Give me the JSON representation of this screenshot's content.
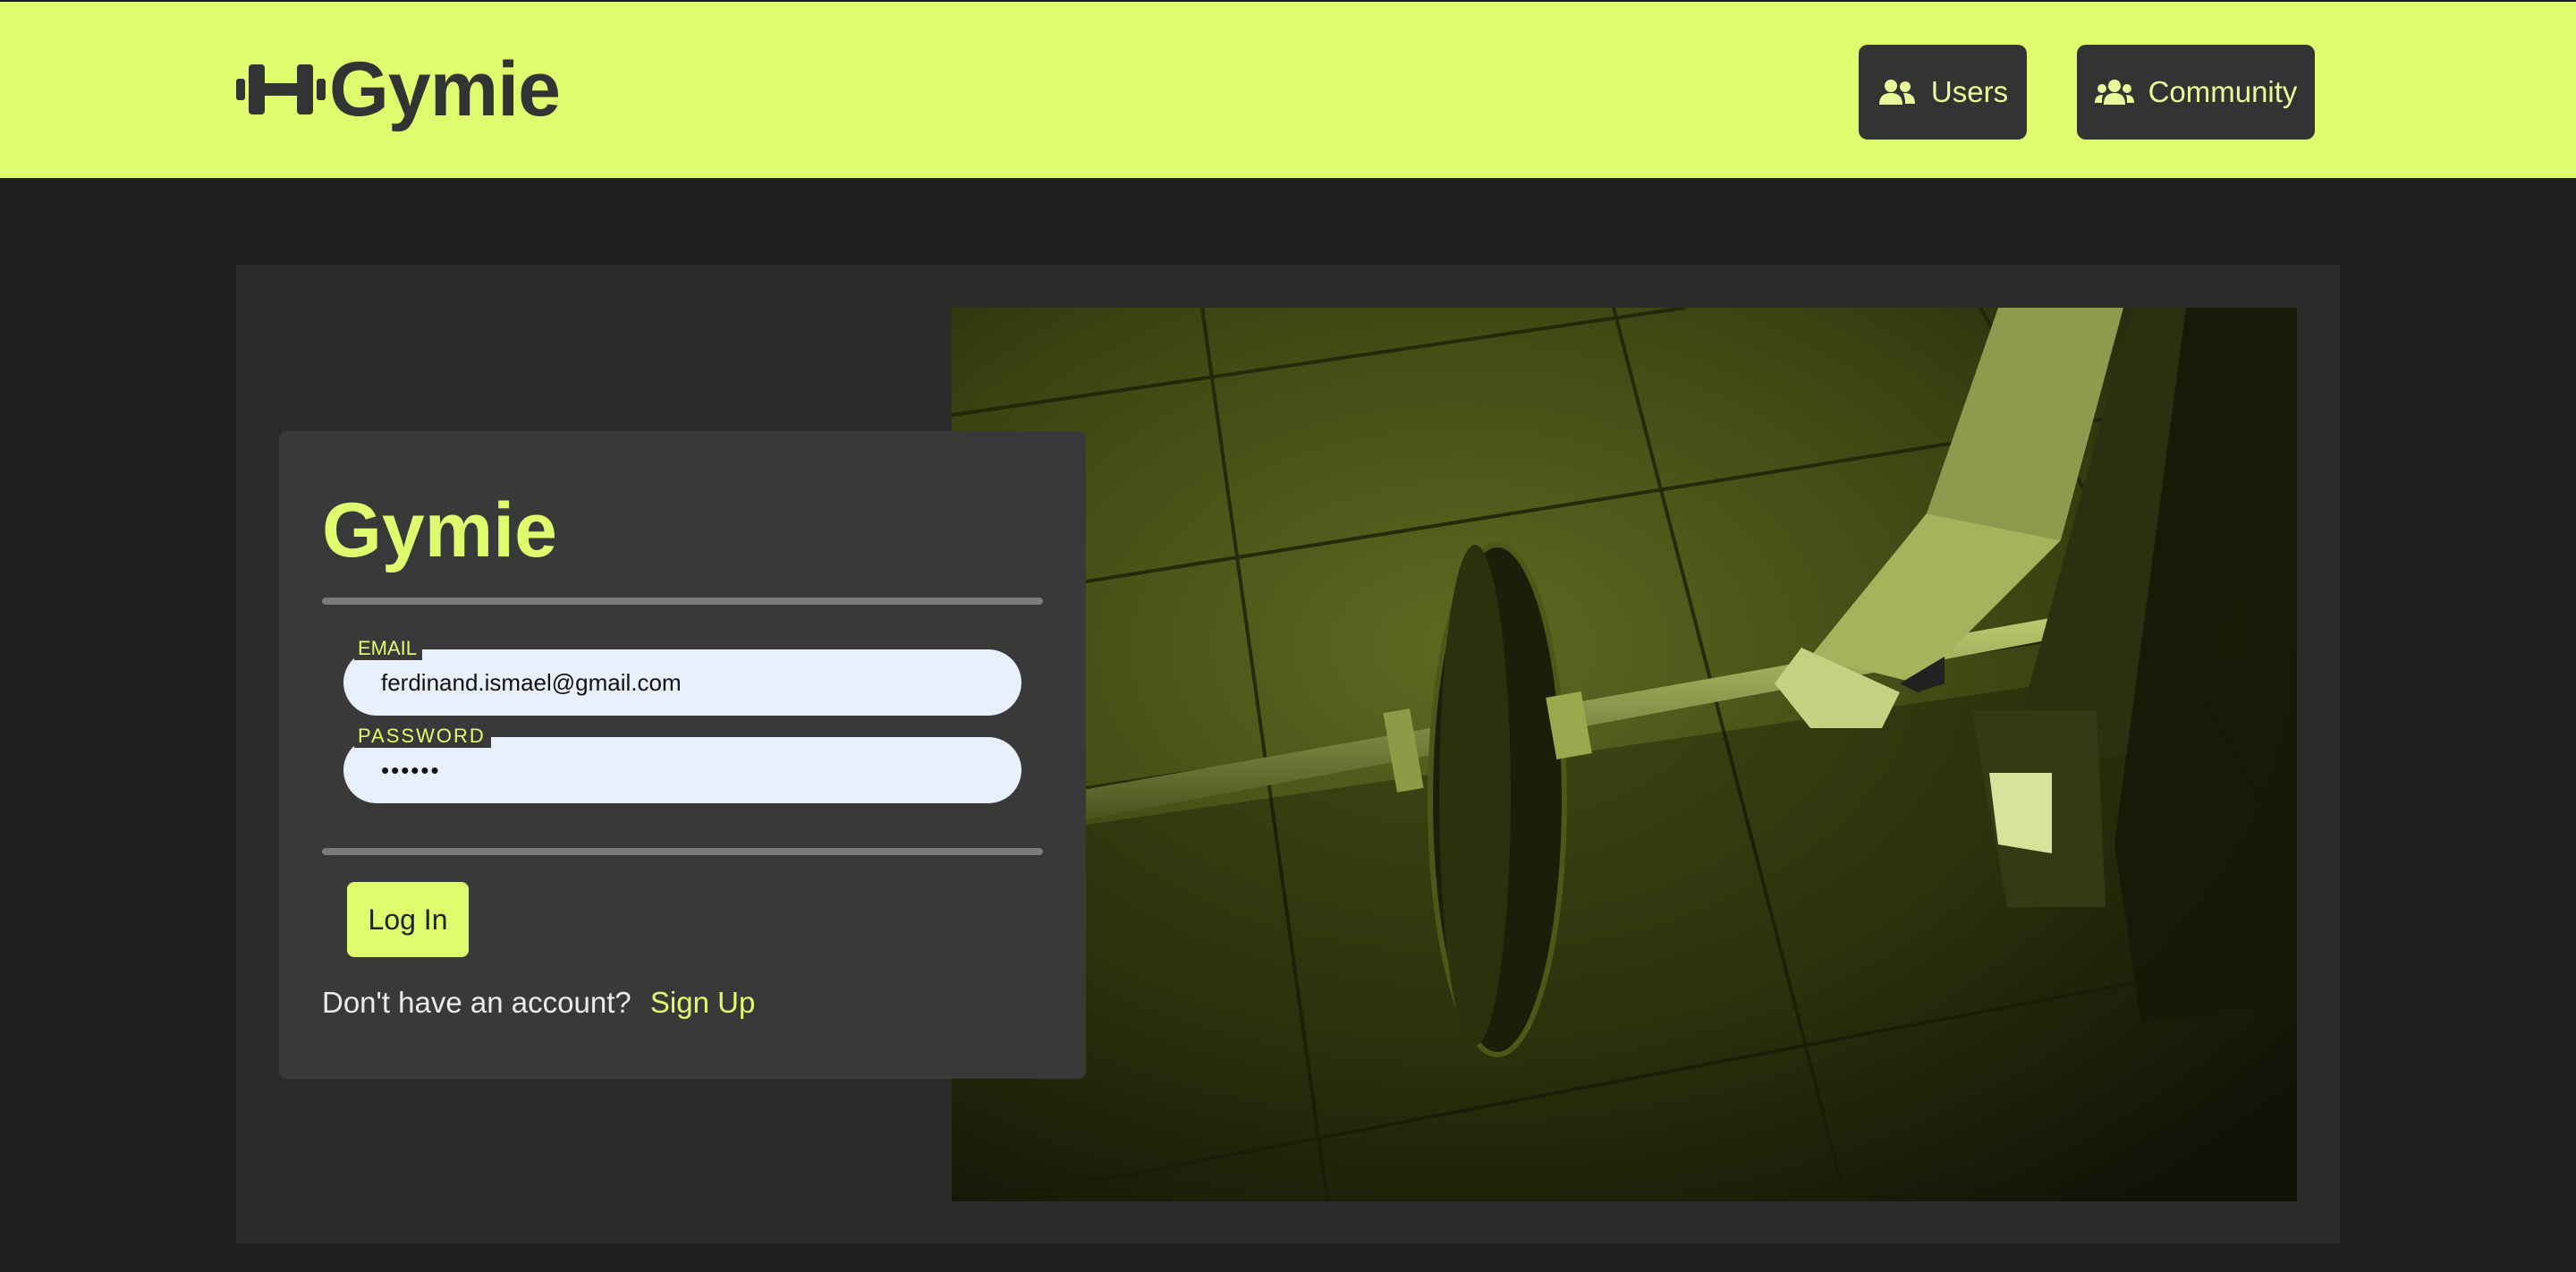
{
  "header": {
    "brand": "Gymie",
    "nav": [
      {
        "label": "Users",
        "icon": "users-icon"
      },
      {
        "label": "Community",
        "icon": "community-icon"
      }
    ]
  },
  "login_card": {
    "title": "Gymie",
    "email": {
      "label": "EMAIL",
      "value": "ferdinand.ismael@gmail.com"
    },
    "password": {
      "label": "PASSWORD",
      "value": "••••••"
    },
    "submit_label": "Log In",
    "signup_prompt": "Don't have an account?",
    "signup_link": "Sign Up"
  },
  "hero_image": {
    "description_icon": "barbell-deadlift-photo"
  },
  "colors": {
    "accent": "#dffb6e",
    "dark": "#333333",
    "background": "#202020",
    "card": "#393939",
    "input": "#e8effd"
  }
}
